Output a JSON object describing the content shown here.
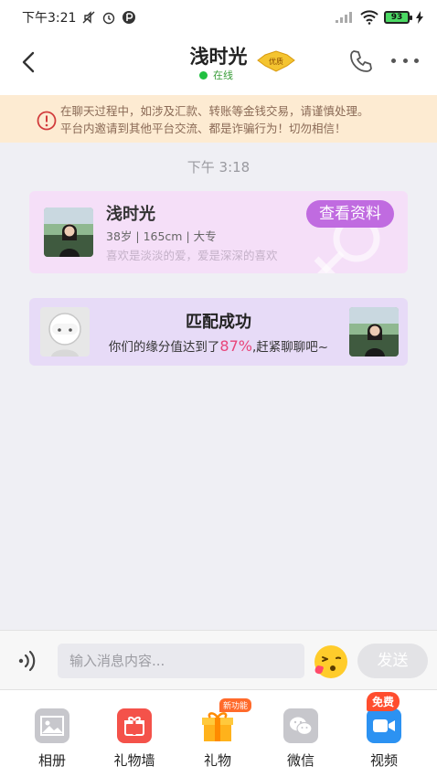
{
  "status_bar": {
    "time": "下午3:21",
    "battery": "93"
  },
  "header": {
    "title": "浅时光",
    "status": "在线",
    "vip_badge": "优质",
    "icons": [
      "back-icon",
      "phone-icon",
      "more-icon"
    ]
  },
  "warning": {
    "line1": "在聊天过程中，如涉及汇款、转账等金钱交易，请谨慎处理。",
    "line2": "平台内邀请到其他平台交流、都是诈骗行为！切勿相信！"
  },
  "chat": {
    "timestamp": "下午 3:18"
  },
  "profile_card": {
    "name": "浅时光",
    "info": "38岁 | 165cm | 大专",
    "motto": "喜欢是淡淡的爱，爱是深深的喜欢",
    "button": "查看资料"
  },
  "match_card": {
    "title": "匹配成功",
    "desc_prefix": "你们的缘分值达到了",
    "percent": "87%",
    "desc_suffix": ",赶紧聊聊吧~"
  },
  "input_bar": {
    "placeholder": "输入消息内容...",
    "send": "发送"
  },
  "toolbar": {
    "items": [
      {
        "label": "相册",
        "icon": "album-icon"
      },
      {
        "label": "礼物墙",
        "icon": "gift-wall-icon"
      },
      {
        "label": "礼物",
        "icon": "gift-icon",
        "badge": "新功能"
      },
      {
        "label": "微信",
        "icon": "wechat-icon"
      },
      {
        "label": "视频",
        "icon": "video-icon",
        "badge": "免费"
      }
    ]
  },
  "colors": {
    "accent": "#c06be0",
    "warning_bg": "#fdebd2",
    "percent": "#e8457a",
    "online": "#20c040"
  }
}
